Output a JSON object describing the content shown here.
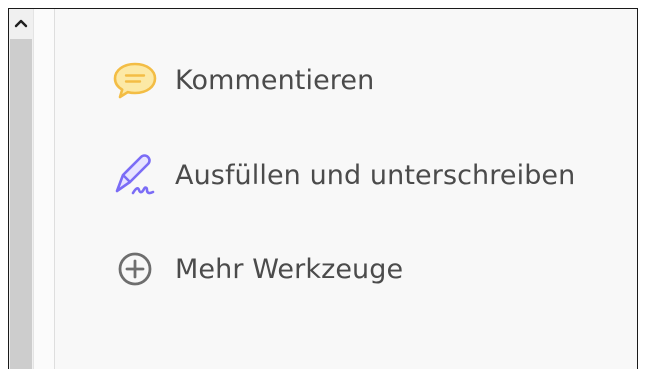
{
  "tools": [
    {
      "label": "Kommentieren",
      "icon": "comment-icon",
      "color": "#F8C448"
    },
    {
      "label": "Ausfüllen und unterschreiben",
      "icon": "fill-sign-icon",
      "color": "#7B6CF6"
    },
    {
      "label": "Mehr Werkzeuge",
      "icon": "add-circle-icon",
      "color": "#707070"
    }
  ],
  "scrollbar": {
    "icon": "chevron-up-icon"
  }
}
